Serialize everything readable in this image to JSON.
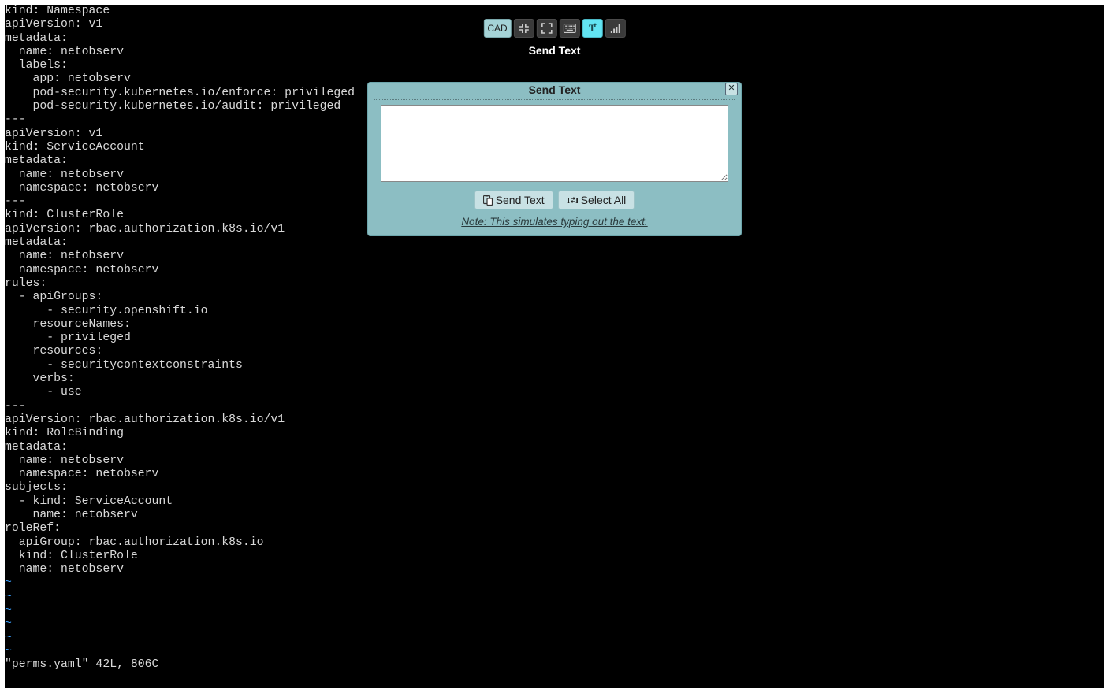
{
  "toolbar": {
    "cad_label": "CAD",
    "tooltip": "Send Text"
  },
  "dialog": {
    "title": "Send Text",
    "textarea_value": "",
    "send_btn": "Send Text",
    "select_all_btn": "Select All",
    "note": "Note: This simulates typing out the text."
  },
  "terminal": {
    "lines": [
      "kind: Namespace",
      "apiVersion: v1",
      "metadata:",
      "  name: netobserv",
      "  labels:",
      "    app: netobserv",
      "    pod-security.kubernetes.io/enforce: privileged",
      "    pod-security.kubernetes.io/audit: privileged",
      "---",
      "apiVersion: v1",
      "kind: ServiceAccount",
      "metadata:",
      "  name: netobserv",
      "  namespace: netobserv",
      "---",
      "kind: ClusterRole",
      "apiVersion: rbac.authorization.k8s.io/v1",
      "metadata:",
      "  name: netobserv",
      "  namespace: netobserv",
      "rules:",
      "  - apiGroups:",
      "      - security.openshift.io",
      "    resourceNames:",
      "      - privileged",
      "    resources:",
      "      - securitycontextconstraints",
      "    verbs:",
      "      - use",
      "---",
      "apiVersion: rbac.authorization.k8s.io/v1",
      "kind: RoleBinding",
      "metadata:",
      "  name: netobserv",
      "  namespace: netobserv",
      "subjects:",
      "  - kind: ServiceAccount",
      "    name: netobserv",
      "roleRef:",
      "  apiGroup: rbac.authorization.k8s.io",
      "  kind: ClusterRole",
      "  name: netobserv"
    ],
    "tilde_count": 6,
    "status": "\"perms.yaml\" 42L, 806C"
  }
}
